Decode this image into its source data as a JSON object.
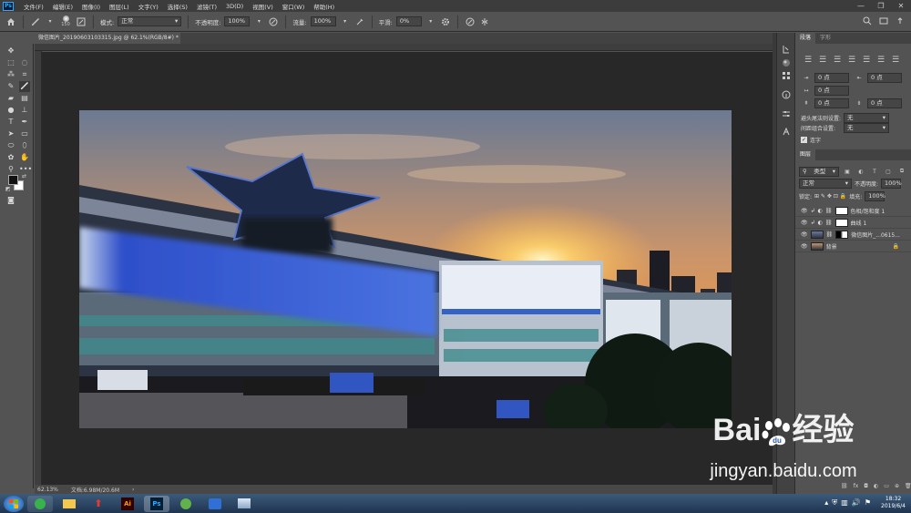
{
  "menubar": {
    "logo": "Ps",
    "items": [
      "文件(F)",
      "编辑(E)",
      "图像(I)",
      "图层(L)",
      "文字(Y)",
      "选择(S)",
      "滤镜(T)",
      "3D(D)",
      "视图(V)",
      "窗口(W)",
      "帮助(H)"
    ],
    "window_controls": [
      "—",
      "❐",
      "✕"
    ]
  },
  "options": {
    "brush_size": "150",
    "mode_label": "模式:",
    "mode_value": "正常",
    "opacity_label": "不透明度:",
    "opacity_value": "100%",
    "flow_label": "流量:",
    "flow_value": "100%",
    "smooth_label": "平滑:",
    "smooth_value": "0%"
  },
  "document": {
    "tab_title": "微信图片_20190603103315.jpg @ 62.1%(RGB/8#) *",
    "tab_close": "×",
    "zoom": "62.13%",
    "doc_info": "文档:6.98M/20.6M"
  },
  "icons": {
    "home": "home-icon",
    "brush": "brush-icon",
    "settings": "gear-icon"
  },
  "panels": {
    "char_tabs": [
      "段落",
      "字形"
    ],
    "fields": [
      "0 点",
      "0 点",
      "0 点",
      "0 点",
      "0 点"
    ],
    "kinsoku_label": "避头尾法则设置:",
    "kinsoku_value": "无",
    "spacing_label": "间距组合设置:",
    "spacing_value": "无",
    "hyphen_label": "连字",
    "layers_tab": "图层",
    "filter_kind": "类型",
    "blend_mode": "正常",
    "opacity_label": "不透明度:",
    "opacity_value": "100%",
    "lock_label": "锁定:",
    "fill_label": "填充:",
    "fill_value": "100%",
    "layers": [
      {
        "name": "色相/饱和度 1"
      },
      {
        "name": "曲线 1"
      },
      {
        "name": "微信图片_...0615..."
      },
      {
        "name": "背景"
      }
    ]
  },
  "taskbar": {
    "apps": [
      "",
      "",
      "",
      "Ai",
      "Ps",
      "",
      "",
      ""
    ],
    "time": "18:32",
    "date": "2019/6/4"
  },
  "watermark": {
    "brand": "Bai",
    "brand_suffix": "经验",
    "url": "jingyan.baidu.com"
  }
}
